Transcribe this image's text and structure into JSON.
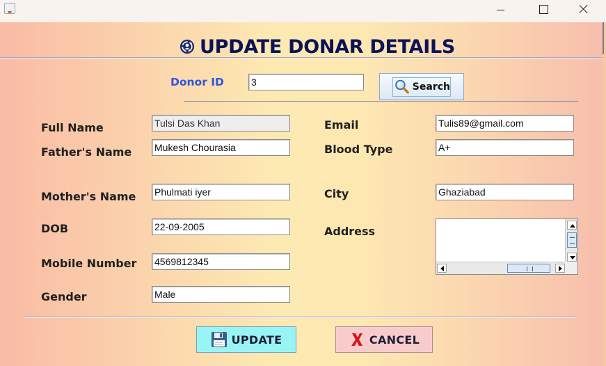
{
  "window": {
    "minimize_glyph": "",
    "icons": {
      "app": "java-app-icon",
      "minimize": "minimize-icon",
      "maximize": "maximize-icon",
      "close": "close-icon"
    }
  },
  "header": {
    "title": "UPDATE DONAR DETAILS",
    "icon": "refresh-user-icon"
  },
  "search": {
    "label": "Donor ID",
    "value": "3",
    "button_label": "Search",
    "button_icon": "magnifier-icon"
  },
  "form": {
    "full_name": {
      "label": "Full Name",
      "value": "Tulsi  Das Khan"
    },
    "fathers_name": {
      "label": "Father's Name",
      "value": "Mukesh Chourasia"
    },
    "mothers_name": {
      "label": "Mother's Name",
      "value": "Phulmati iyer"
    },
    "dob": {
      "label": "DOB",
      "value": "22-09-2005"
    },
    "mobile": {
      "label": "Mobile Number",
      "value": "4569812345"
    },
    "gender": {
      "label": "Gender",
      "value": "Male"
    },
    "email": {
      "label": "Email",
      "value": "Tulis89@gmail.com"
    },
    "blood_type": {
      "label": "Blood Type",
      "value": "A+"
    },
    "city": {
      "label": "City",
      "value": "Ghaziabad"
    },
    "address": {
      "label": "Address",
      "value": ""
    }
  },
  "actions": {
    "update_label": "UPDATE",
    "update_icon": "floppy-disk-icon",
    "cancel_label": "CANCEL",
    "cancel_icon": "red-x-icon"
  },
  "colors": {
    "title": "#0b1358",
    "donor_label": "#2f55dd",
    "update_button": "#99f5f5",
    "cancel_button": "#f8cccc"
  }
}
